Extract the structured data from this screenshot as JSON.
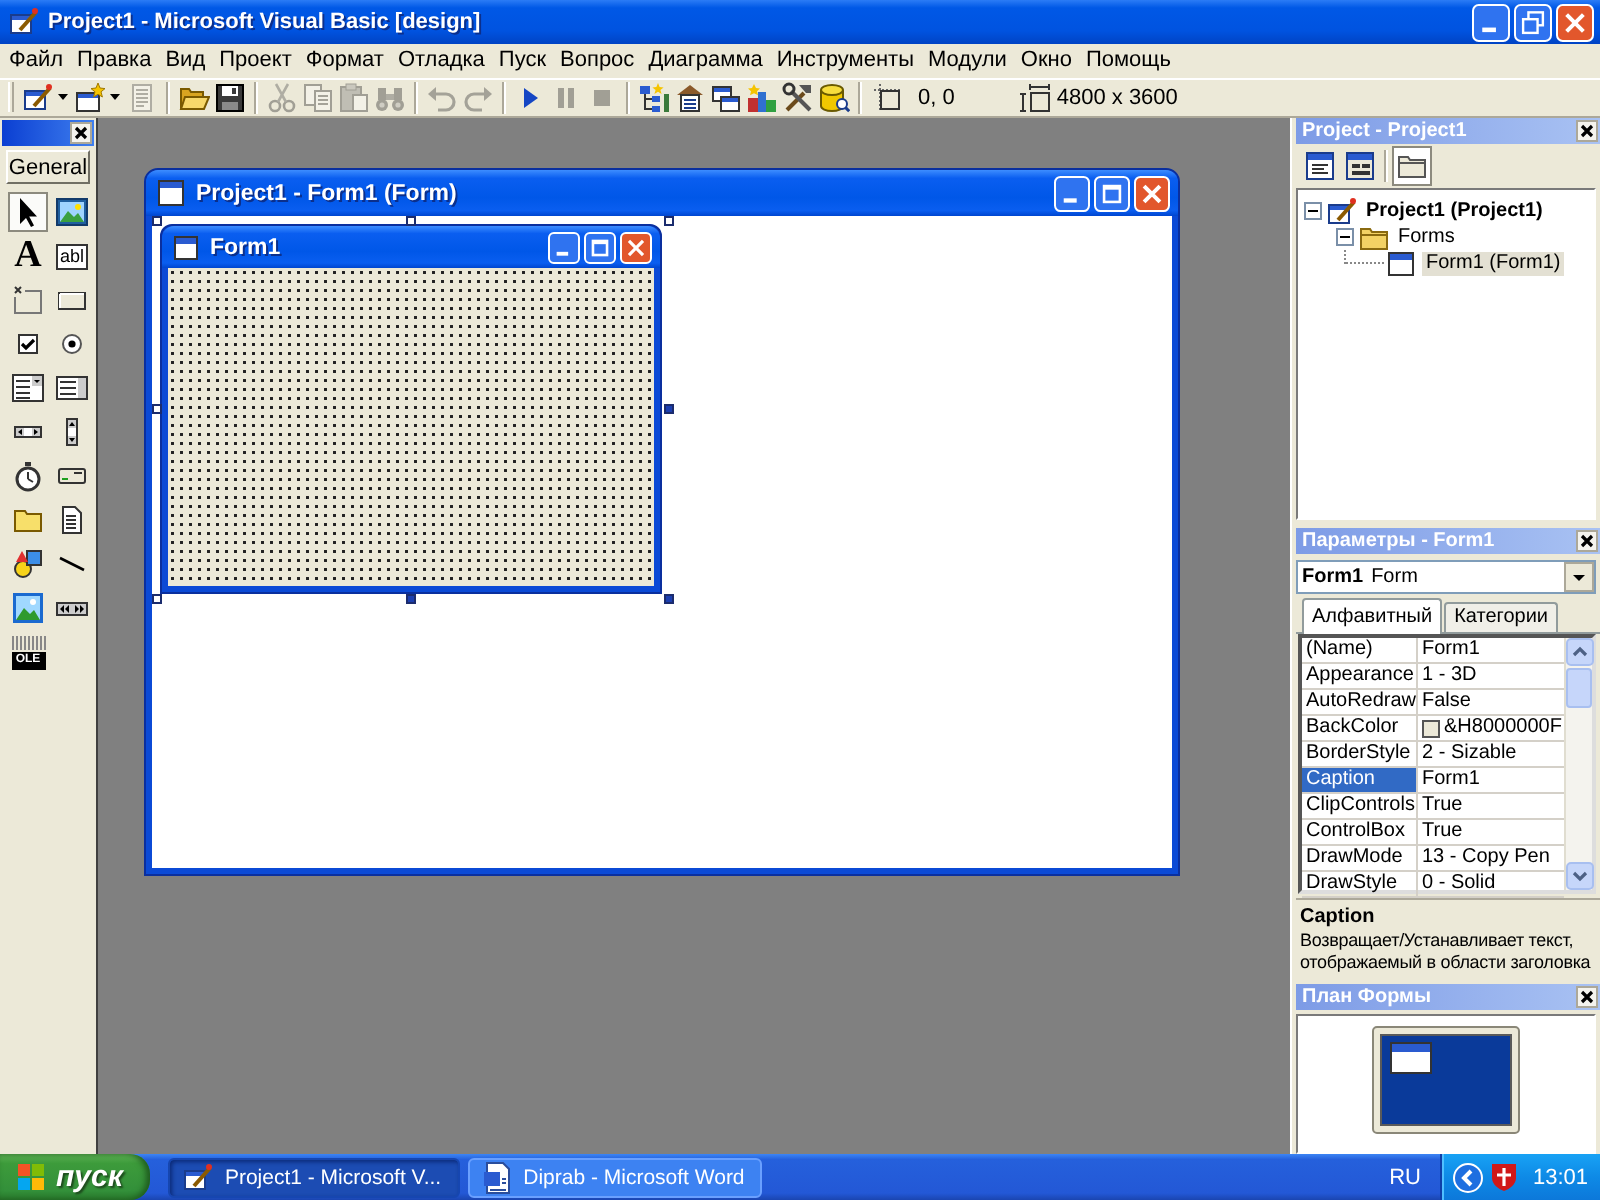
{
  "window": {
    "title": "Project1 - Microsoft Visual Basic [design]"
  },
  "menu": [
    "Файл",
    "Правка",
    "Вид",
    "Проект",
    "Формат",
    "Отладка",
    "Пуск",
    "Вопрос",
    "Диаграмма",
    "Инструменты",
    "Модули",
    "Окно",
    "Помощь"
  ],
  "toolbar": {
    "groups": [
      [
        {
          "disabled": false,
          "dropdown": true
        },
        {
          "disabled": false,
          "dropdown": true
        },
        {
          "disabled": true,
          "dropdown": false
        }
      ],
      [
        {
          "disabled": false,
          "dropdown": false
        },
        {
          "disabled": false,
          "dropdown": false
        }
      ],
      [
        {
          "disabled": true,
          "dropdown": false
        },
        {
          "disabled": true,
          "dropdown": false
        },
        {
          "disabled": true,
          "dropdown": false
        },
        {
          "disabled": true,
          "dropdown": false
        }
      ],
      [
        {
          "disabled": true,
          "dropdown": false
        },
        {
          "disabled": true,
          "dropdown": false
        }
      ],
      [
        {
          "disabled": false,
          "dropdown": false
        },
        {
          "disabled": true,
          "dropdown": false
        },
        {
          "disabled": true,
          "dropdown": false
        }
      ],
      [
        {
          "disabled": false,
          "dropdown": false
        },
        {
          "disabled": false,
          "dropdown": false
        },
        {
          "disabled": false,
          "dropdown": false
        },
        {
          "disabled": false,
          "dropdown": false
        },
        {
          "disabled": false,
          "dropdown": false
        },
        {
          "disabled": false,
          "dropdown": false
        }
      ]
    ],
    "position": "0, 0",
    "size": "4800 x 3600"
  },
  "toolbox": {
    "active": true,
    "tab": "General",
    "tools": [
      {
        "selected": true
      },
      {
        "selected": false
      },
      {
        "selected": false,
        "glyph": "A"
      },
      {
        "selected": false,
        "glyph": "abl"
      },
      {
        "selected": false
      },
      {
        "selected": false
      },
      {
        "selected": false
      },
      {
        "selected": false
      },
      {
        "selected": false
      },
      {
        "selected": false
      },
      {
        "selected": false
      },
      {
        "selected": false
      },
      {
        "selected": false
      },
      {
        "selected": false
      },
      {
        "selected": false
      },
      {
        "selected": false
      },
      {
        "selected": false
      },
      {
        "selected": false
      },
      {
        "selected": false
      },
      {
        "selected": false
      },
      {
        "selected": false,
        "glyph": "OLE"
      }
    ]
  },
  "designer": {
    "title": "Project1 - Form1 (Form)",
    "form": {
      "title": "Form1"
    }
  },
  "project": {
    "title": "Project - Project1",
    "active": false,
    "buttons": [
      {
        "pressed": false
      },
      {
        "pressed": false
      },
      {
        "pressed": true
      }
    ],
    "tree": [
      {
        "label": "Project1 (Project1)",
        "expanded": true,
        "selected": false,
        "children": [
          {
            "label": "Forms",
            "expanded": true,
            "selected": false,
            "children": [
              {
                "label": "Form1 (Form1)",
                "selected": true
              }
            ]
          }
        ]
      }
    ]
  },
  "properties": {
    "title": "Параметры - Form1",
    "active": false,
    "object_name": "Form1",
    "object_type": "Form",
    "tabs": [
      {
        "label": "Алфавитный",
        "selected": true
      },
      {
        "label": "Категории",
        "selected": false
      }
    ],
    "rows": [
      {
        "name": "(Name)",
        "value": "Form1",
        "selected": false
      },
      {
        "name": "Appearance",
        "value": "1 - 3D",
        "selected": false
      },
      {
        "name": "AutoRedraw",
        "value": "False",
        "selected": false
      },
      {
        "name": "BackColor",
        "value": "&H8000000F",
        "color": "#ece9d8",
        "selected": false
      },
      {
        "name": "BorderStyle",
        "value": "2 - Sizable",
        "selected": false
      },
      {
        "name": "Caption",
        "value": "Form1",
        "selected": true
      },
      {
        "name": "ClipControls",
        "value": "True",
        "selected": false
      },
      {
        "name": "ControlBox",
        "value": "True",
        "selected": false
      },
      {
        "name": "DrawMode",
        "value": "13 - Copy Pen",
        "selected": false
      },
      {
        "name": "DrawStyle",
        "value": "0 - Solid",
        "selected": false
      }
    ],
    "description": {
      "title": "Caption",
      "text": "Возвращает/Устанавливает текст, отображаемый в области заголовка"
    }
  },
  "form_layout": {
    "title": "План Формы",
    "active": false
  },
  "taskbar": {
    "start": "пуск",
    "tasks": [
      {
        "label": "Project1 - Microsoft V...",
        "selected": true
      },
      {
        "label": "Diprab - Microsoft Word",
        "selected": false
      }
    ],
    "language": "RU",
    "clock": "13:01"
  }
}
